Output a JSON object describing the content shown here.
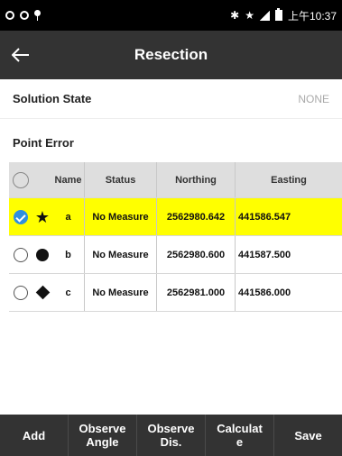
{
  "status_bar": {
    "time": "上午10:37",
    "icons": [
      "ring-icon",
      "ring-icon",
      "pin-icon",
      "bluetooth-icon",
      "star-icon",
      "signal-icon",
      "battery-icon"
    ]
  },
  "header": {
    "title": "Resection",
    "back_icon": "arrow-left-icon"
  },
  "info": {
    "solution_state_label": "Solution State",
    "solution_state_value": "NONE",
    "point_error_label": "Point Error"
  },
  "table": {
    "columns": [
      "Name",
      "Status",
      "Northing",
      "Easting"
    ],
    "rows": [
      {
        "shape": "star",
        "name": "a",
        "status": "No Measure",
        "northing": "2562980.642",
        "easting": "441586.547",
        "selected": true
      },
      {
        "shape": "circle",
        "name": "b",
        "status": "No Measure",
        "northing": "2562980.600",
        "easting": "441587.500",
        "selected": false
      },
      {
        "shape": "diamond",
        "name": "c",
        "status": "No Measure",
        "northing": "2562981.000",
        "easting": "441586.000",
        "selected": false
      }
    ]
  },
  "toolbar": {
    "add": "Add",
    "observe_angle": "Observe\nAngle",
    "observe_dis": "Observe\nDis.",
    "calculate": "Calculat\ne",
    "save": "Save"
  },
  "colors": {
    "bar_background": "#333333",
    "selected_row": "#ffff00",
    "checked_radio": "#2f8fe0"
  }
}
